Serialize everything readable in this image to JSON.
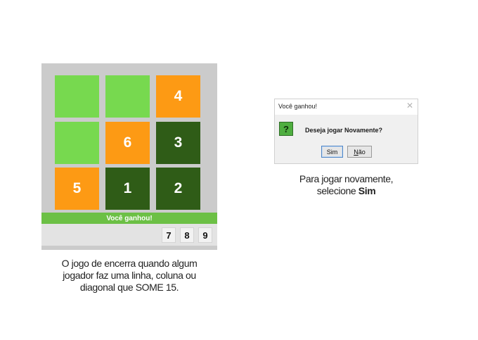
{
  "board": {
    "cells": [
      {
        "value": "",
        "color": "#77d94f",
        "state": "empty"
      },
      {
        "value": "",
        "color": "#77d94f",
        "state": "empty"
      },
      {
        "value": "4",
        "color": "#fd9a14",
        "state": "orange"
      },
      {
        "value": "",
        "color": "#77d94f",
        "state": "empty"
      },
      {
        "value": "6",
        "color": "#fd9a14",
        "state": "orange"
      },
      {
        "value": "3",
        "color": "#2f5c17",
        "state": "dark"
      },
      {
        "value": "5",
        "color": "#fd9a14",
        "state": "orange"
      },
      {
        "value": "1",
        "color": "#2f5c17",
        "state": "dark"
      },
      {
        "value": "2",
        "color": "#2f5c17",
        "state": "dark"
      }
    ],
    "status_text": "Você ganhou!",
    "remaining_numbers": [
      "7",
      "8",
      "9"
    ]
  },
  "caption_left": {
    "line1": "O jogo de encerra quando algum",
    "line2": "jogador faz uma linha, coluna ou",
    "line3": "diagonal que SOME 15."
  },
  "dialog": {
    "title": "Você ganhou!",
    "close_glyph": "✕",
    "icon_glyph": "?",
    "message": "Deseja jogar Novamente?",
    "yes_label": "Sim",
    "no_first": "N",
    "no_rest": "ão"
  },
  "caption_right": {
    "line1": "Para jogar novamente,",
    "line2_prefix": "selecione ",
    "line2_bold": "Sim"
  },
  "colors": {
    "empty": "#77d94f",
    "player_orange": "#fd9a14",
    "player_dark": "#2f5c17",
    "status_bar": "#6cc045"
  }
}
